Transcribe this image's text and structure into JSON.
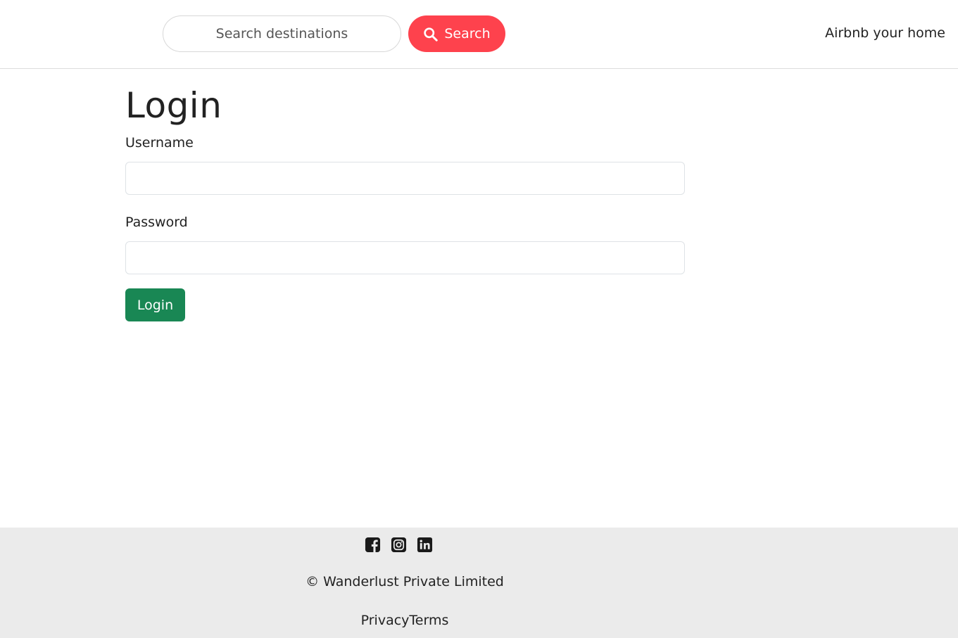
{
  "navbar": {
    "search_placeholder": "Search destinations",
    "search_button_label": "Search",
    "host_link_label": "Airbnb your home"
  },
  "form": {
    "title": "Login",
    "username_label": "Username",
    "username_value": "",
    "password_label": "Password",
    "password_value": "",
    "submit_label": "Login"
  },
  "footer": {
    "social_icons": [
      "facebook-icon",
      "instagram-icon",
      "linkedin-icon"
    ],
    "copyright": "© Wanderlust Private Limited",
    "links": [
      "Privacy",
      "Terms"
    ]
  },
  "colors": {
    "brand_red": "#fe424d",
    "success_green": "#198754",
    "footer_bg": "#ebebeb"
  }
}
